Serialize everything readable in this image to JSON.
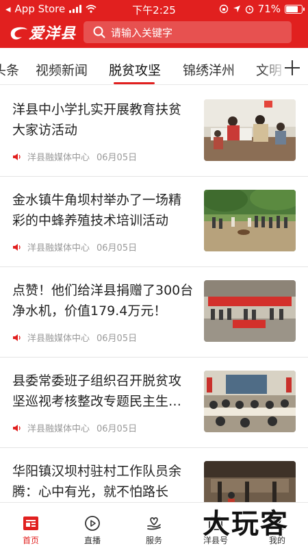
{
  "status_bar": {
    "carrier": "App Store",
    "time": "下午2:25",
    "battery": "71%",
    "battery_level": 0.71
  },
  "header": {
    "logo_text": "爱洋县",
    "search_placeholder": "请输入关键字",
    "accent_color": "#e1201f"
  },
  "tabs": [
    "头条",
    "视频新闻",
    "脱贫攻坚",
    "锦绣洋州",
    "文明"
  ],
  "active_tab": "脱贫攻坚",
  "news": [
    {
      "title": "洋县中小学扎实开展教育扶贫大家访活动",
      "source": "洋县融媒体中心",
      "date": "06月05日"
    },
    {
      "title": "金水镇牛角坝村举办了一场精彩的中蜂养殖技术培训活动",
      "source": "洋县融媒体中心",
      "date": "06月05日"
    },
    {
      "title": "点赞！他们给洋县捐赠了300台净水机，价值179.4万元！",
      "source": "洋县融媒体中心",
      "date": "06月05日"
    },
    {
      "title": "县委常委班子组织召开脱贫攻坚巡视考核整改专题民主生…",
      "source": "洋县融媒体中心",
      "date": "06月05日"
    },
    {
      "title": "华阳镇汉坝村驻村工作队员余腾：心中有光，就不怕路长",
      "source": "",
      "date": ""
    }
  ],
  "bottom_nav": [
    {
      "label": "首页",
      "icon": "home-icon"
    },
    {
      "label": "直播",
      "icon": "play-icon"
    },
    {
      "label": "服务",
      "icon": "heart-hand-icon"
    },
    {
      "label": "洋县号",
      "icon": "id-icon"
    },
    {
      "label": "我的",
      "icon": "user-icon"
    }
  ],
  "watermark": "大玩客"
}
